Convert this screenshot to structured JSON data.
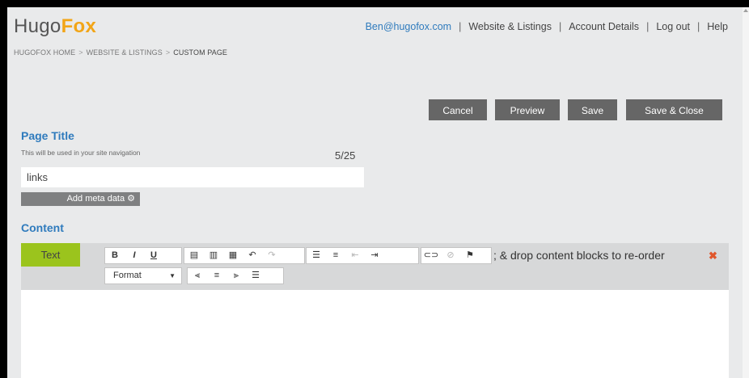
{
  "header": {
    "logo_part1": "Hugo",
    "logo_part2": "Fox",
    "email": "Ben@hugofox.com",
    "nav": [
      "Website & Listings",
      "Account Details",
      "Log out",
      "Help"
    ],
    "separator": "|"
  },
  "breadcrumb": {
    "items": [
      "HUGOFOX HOME",
      "WEBSITE & LISTINGS",
      "CUSTOM PAGE"
    ],
    "separator": ">"
  },
  "actions": {
    "cancel": "Cancel",
    "preview": "Preview",
    "save": "Save",
    "save_close": "Save & Close"
  },
  "page_title": {
    "heading": "Page Title",
    "hint": "This will be used in your site navigation",
    "counter": "5/25",
    "value": "links",
    "meta_button": "Add meta data"
  },
  "content": {
    "heading": "Content",
    "tab_label": "Text",
    "format_label": "Format",
    "drag_message": "; & drop content blocks to re-order",
    "close_symbol": "✖"
  },
  "toolbar": {
    "bold": "B",
    "italic": "I",
    "underline": "U"
  },
  "colors": {
    "brand_blue": "#2f7bbd",
    "brand_orange": "#f2a517",
    "tab_green": "#9bc41d",
    "button_gray": "#666666"
  }
}
